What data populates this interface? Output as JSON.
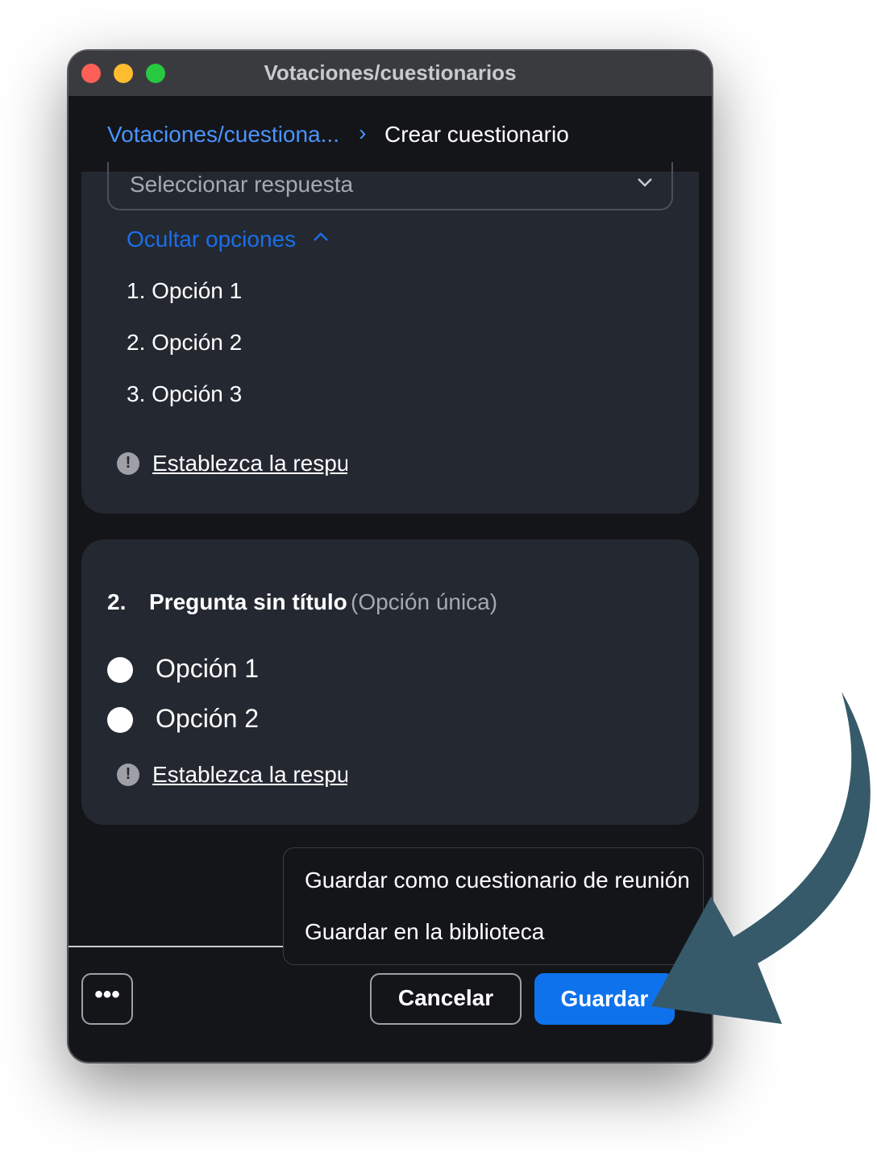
{
  "window": {
    "title": "Votaciones/cuestionarios",
    "traffic_lights": {
      "close_color": "#fe5f57",
      "minimize_color": "#febc2e",
      "maximize_color": "#28c840"
    }
  },
  "breadcrumb": {
    "parent": "Votaciones/cuestiona...",
    "separator": "›",
    "current": "Crear cuestionario"
  },
  "question1": {
    "select_placeholder": "Seleccionar respuesta",
    "toggle_label": "Ocultar opciones",
    "options": [
      "1. Opción 1",
      "2. Opción 2",
      "3. Opción 3"
    ],
    "warning_link": "Establezca la respue"
  },
  "question2": {
    "number": "2.",
    "title": "Pregunta sin título",
    "type": "(Opción única)",
    "options": [
      "Opción 1",
      "Opción 2"
    ],
    "warning_link": "Establezca la respue"
  },
  "save_menu": {
    "items": [
      "Guardar como cuestionario de reunión",
      "Guardar en la biblioteca"
    ]
  },
  "footer": {
    "more_label": "•••",
    "cancel_label": "Cancelar",
    "save_label": "Guardar"
  },
  "colors": {
    "accent": "#0e72ed",
    "link": "#4a94ff",
    "card_bg": "#242831",
    "window_bg": "#141519",
    "annotation_arrow": "#365a6a"
  },
  "icons": [
    "chevron-down-icon",
    "chevron-up-icon",
    "chevron-right-icon",
    "warning-icon",
    "annotation-arrow"
  ]
}
